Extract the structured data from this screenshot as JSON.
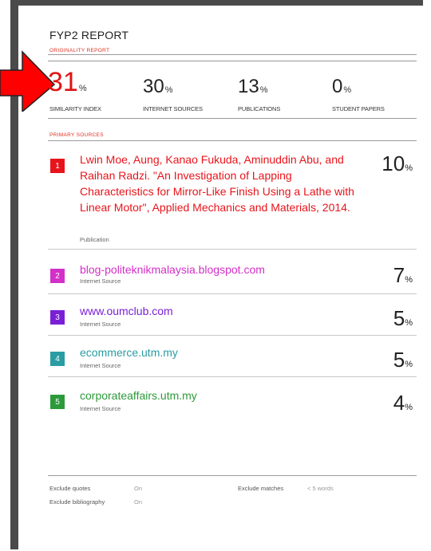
{
  "report": {
    "title": "FYP2 REPORT",
    "originality_label": "ORIGINALITY REPORT",
    "primary_label": "PRIMARY SOURCES"
  },
  "stats": {
    "similarity": {
      "value": "31",
      "unit": "%",
      "label": "SIMILARITY INDEX"
    },
    "internet": {
      "value": "30",
      "unit": "%",
      "label": "INTERNET SOURCES"
    },
    "publications": {
      "value": "13",
      "unit": "%",
      "label": "PUBLICATIONS"
    },
    "student": {
      "value": "0",
      "unit": "%",
      "label": "STUDENT PAPERS"
    }
  },
  "sources": [
    {
      "num": "1",
      "title": "Lwin Moe, Aung, Kanao Fukuda, Aminuddin Abu, and Raihan Radzi. \"An Investigation of Lapping Characteristics for Mirror-Like Finish Using a Lathe with Linear Motor\", Applied Mechanics and Materials, 2014.",
      "type": "Publication",
      "pct": "10",
      "color": "#e8141b"
    },
    {
      "num": "2",
      "title": "blog-politeknikmalaysia.blogspot.com",
      "type": "Internet Source",
      "pct": "7",
      "color": "#d42fc8"
    },
    {
      "num": "3",
      "title": "www.oumclub.com",
      "type": "Internet Source",
      "pct": "5",
      "color": "#7a1fd6"
    },
    {
      "num": "4",
      "title": "ecommerce.utm.my",
      "type": "Internet Source",
      "pct": "5",
      "color": "#2a9ca3"
    },
    {
      "num": "5",
      "title": "corporateaffairs.utm.my",
      "type": "Internet Source",
      "pct": "4",
      "color": "#2c9a3a"
    }
  ],
  "percent_sign": "%",
  "footer": {
    "exclude_quotes": "Exclude quotes",
    "exclude_quotes_val": "On",
    "exclude_biblio": "Exclude bibliography",
    "exclude_biblio_val": "On",
    "exclude_matches": "Exclude matches",
    "exclude_matches_val": "< 5 words"
  },
  "colors": {
    "accent_red": "#e01414",
    "arrow": "#ff0000"
  }
}
